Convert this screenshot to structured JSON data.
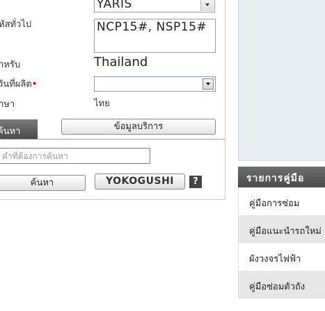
{
  "form": {
    "labels": {
      "general_code": "หัสทั่วไป",
      "for": "ำหรับ",
      "production_date": "วันที่ผลิต",
      "production_date_required": "•",
      "language": "าษา"
    },
    "model_value": "YARIS",
    "general_code_value": "NCP15#, NSP15#",
    "for_value": "Thailand",
    "production_date_value": "",
    "language_value": "ไทย",
    "required_color": "#cc0000"
  },
  "tabs": {
    "search_tab": "ค้นหา",
    "service_info_button": "ข้อมูลบริการ"
  },
  "search": {
    "placeholder": "คำที่ต้องการค้นหา",
    "button": "ค้นหา",
    "yokogushi_button": "YOKOGUSHI",
    "help_icon": "?"
  },
  "manual_list": {
    "header": "รายการคู่มือ",
    "items": [
      {
        "label": "คู่มือการซ่อม"
      },
      {
        "label": "คู่มือแนะนำรถใหม่"
      },
      {
        "label": "ผังวงจรไฟฟ้า"
      },
      {
        "label": "คู่มือซ่อมตัวถัง"
      }
    ]
  },
  "colors": {
    "panel_bg": "#e8edf1",
    "header_bg": "#4a4a4a",
    "alt_row": "#e6e6e6"
  },
  "icons": [
    "dropdown-arrow-icon",
    "help-icon"
  ]
}
